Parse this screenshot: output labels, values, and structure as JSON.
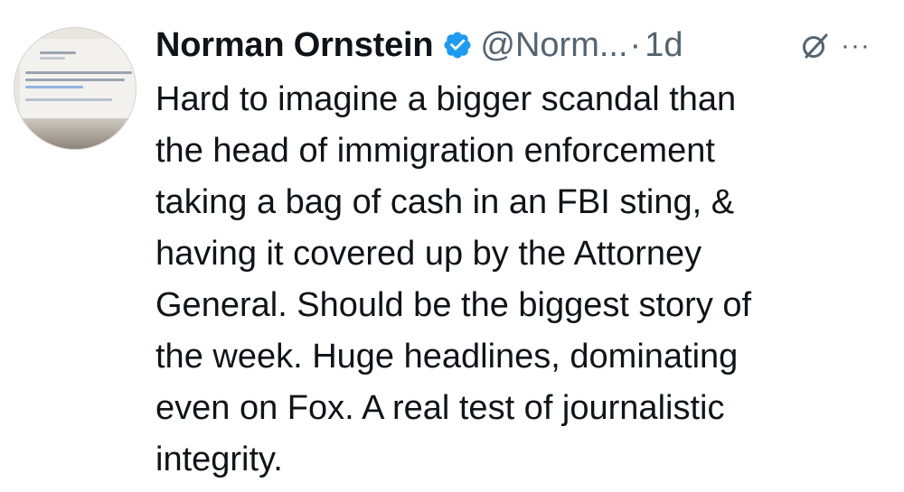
{
  "author": {
    "name": "Norman Ornstein",
    "handle": "@Norm...",
    "verified": true,
    "verified_color": "#1d9bf0"
  },
  "meta": {
    "separator": "·",
    "time": "1d"
  },
  "icons": {
    "avatar": "profile-avatar",
    "verified": "verified-badge-icon",
    "grok": "grok-icon",
    "more": "more-options-icon"
  },
  "more_label": "···",
  "tweet_lines": [
    "Hard to imagine a bigger scandal than",
    "the head of immigration enforcement",
    "taking a bag of cash in an FBI sting, &",
    "having it covered up by the Attorney",
    "General. Should be the biggest story of",
    "the week. Huge headlines, dominating",
    "even on Fox. A real test of journalistic",
    "integrity."
  ]
}
